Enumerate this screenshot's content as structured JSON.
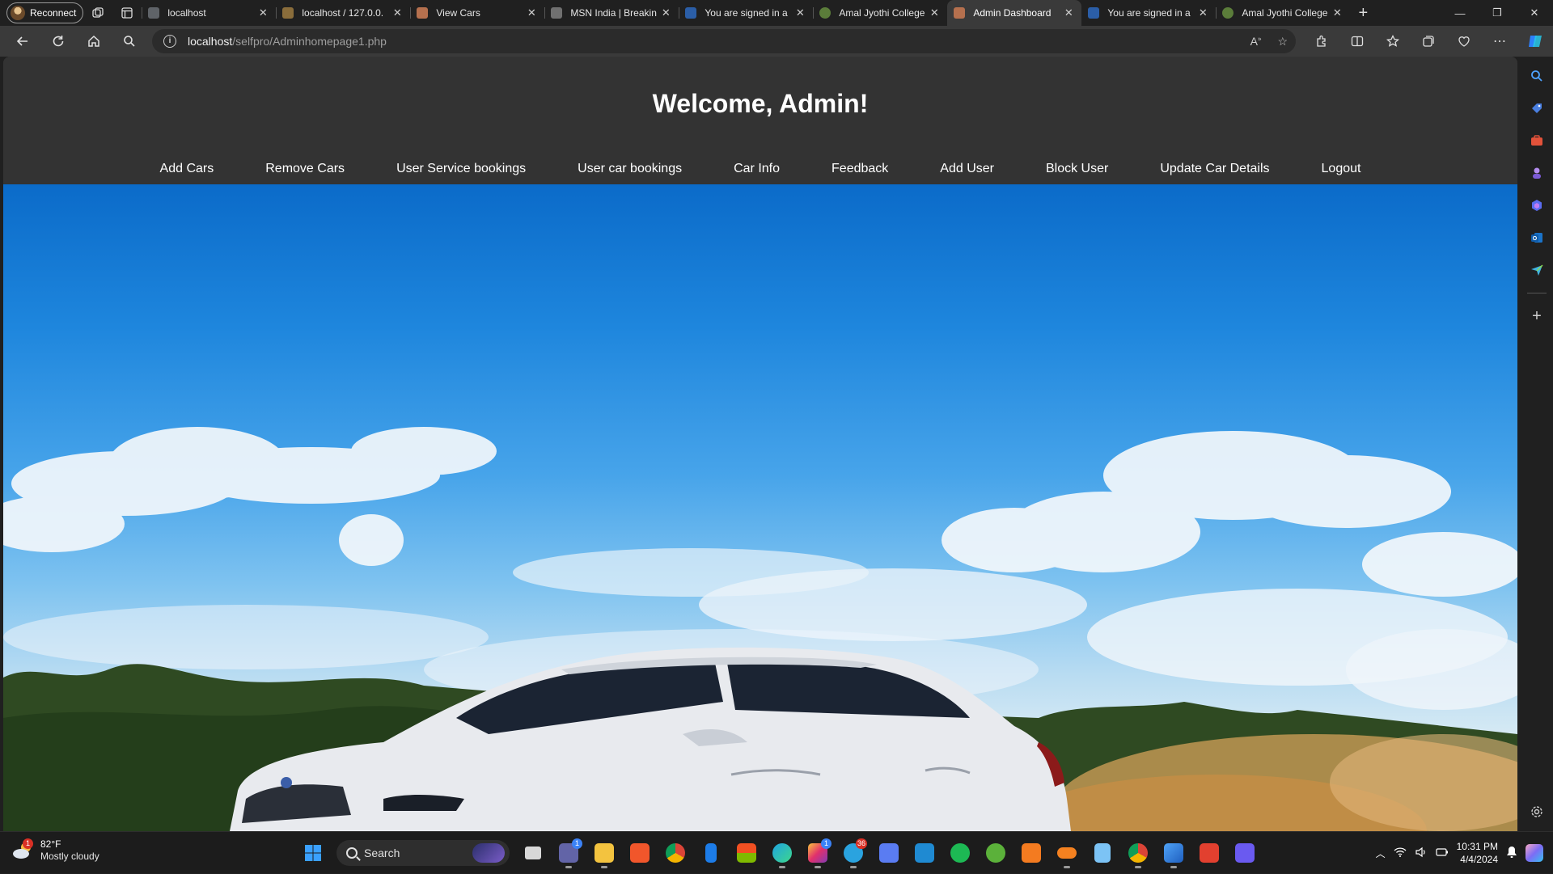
{
  "browser": {
    "profile_label": "Reconnect",
    "tabs": [
      {
        "title": "localhost",
        "favicon_color": "#5f6368"
      },
      {
        "title": "localhost / 127.0.0.",
        "favicon_color": "#8a6d3b"
      },
      {
        "title": "View Cars",
        "favicon_color": "#b5704e"
      },
      {
        "title": "MSN India | Breakin",
        "favicon_color": "#707070"
      },
      {
        "title": "You are signed in a",
        "favicon_color": "#2b5ea7"
      },
      {
        "title": "Amal Jyothi College",
        "favicon_color": "#5b7d3a"
      },
      {
        "title": "Admin Dashboard",
        "favicon_color": "#b5704e"
      },
      {
        "title": "You are signed in a",
        "favicon_color": "#2b5ea7"
      },
      {
        "title": "Amal Jyothi College",
        "favicon_color": "#5b7d3a"
      }
    ],
    "active_tab_index": 6,
    "url_host": "localhost",
    "url_path": "/selfpro/Adminhomepage1.php"
  },
  "page": {
    "heading": "Welcome, Admin!",
    "nav": [
      "Add Cars",
      "Remove Cars",
      "User Service bookings",
      "User car bookings",
      "Car Info",
      "Feedback",
      "Add User",
      "Block User",
      "Update Car Details",
      "Logout"
    ]
  },
  "taskbar": {
    "weather_temp": "82°F",
    "weather_condition": "Mostly cloudy",
    "weather_badge": "1",
    "search_label": "Search",
    "time": "10:31 PM",
    "date": "4/4/2024",
    "teams_badge": "1",
    "instagram_badge": "1",
    "telegram_badge": "36"
  },
  "colors": {
    "header_bg": "#333333",
    "nav_text": "#ffffff",
    "chrome_bg": "#202020",
    "toolbar_bg": "#3a3a3a"
  }
}
